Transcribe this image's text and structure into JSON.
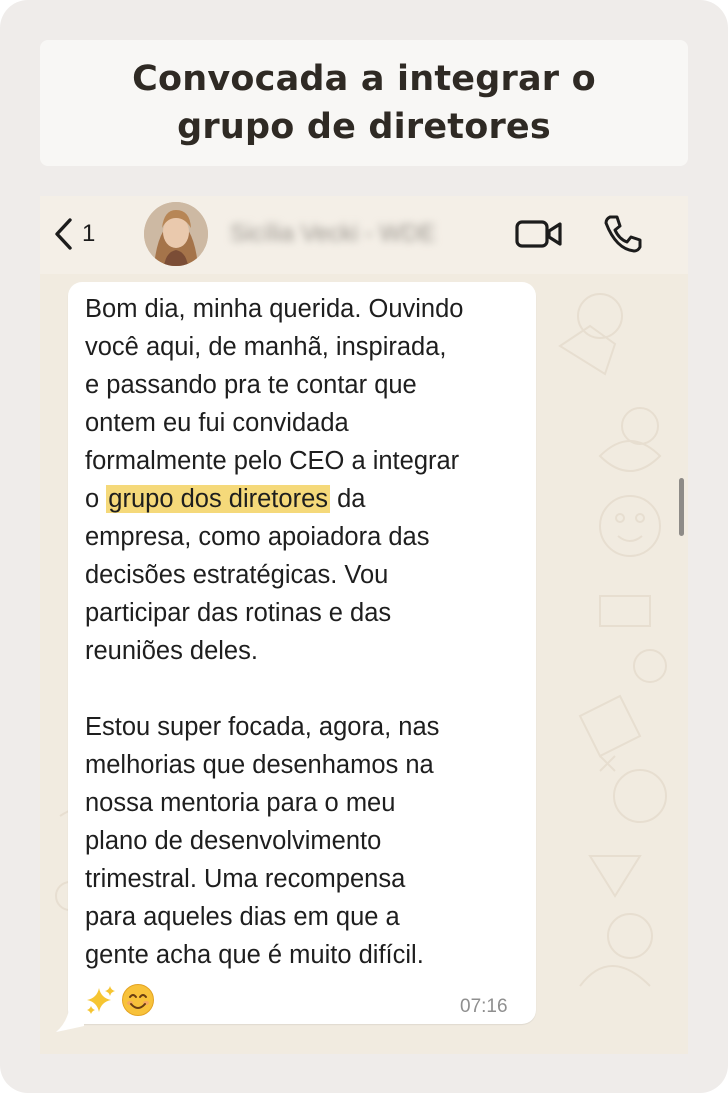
{
  "title": {
    "line1": "Convocada a integrar o",
    "line2": "grupo de diretores"
  },
  "header": {
    "back_count": "1",
    "contact_name": "Sicília Vecki - WDE",
    "icons": [
      "chevron-left-icon",
      "avatar",
      "video-camera-icon",
      "phone-icon"
    ]
  },
  "message": {
    "p1_part1": "Bom dia, minha querida. Ouvindo\nvocê aqui, de manhã, inspirada,\ne passando pra te contar que\nontem eu fui convidada\nformalmente pelo CEO a integrar\no ",
    "p1_highlight": "grupo dos diretores",
    "p1_part2": " da\nempresa, como apoiadora das\ndecisões estratégicas. Vou\nparticipar das rotinas e das\nreuniões deles.\n\nEstou super focada, agora, nas\nmelhorias que desenhamos na\nnossa mentoria para o meu\nplano de desenvolvimento\ntrimestral. Uma recompensa\npara aqueles dias em que a\ngente acha que é muito difícil.",
    "time": "07:16",
    "highlight_color": "#f5d97a"
  },
  "colors": {
    "card_bg": "#efecea",
    "title_bg": "#f8f7f5",
    "chat_bg": "#f1ebe0",
    "bubble_bg": "#ffffff"
  }
}
